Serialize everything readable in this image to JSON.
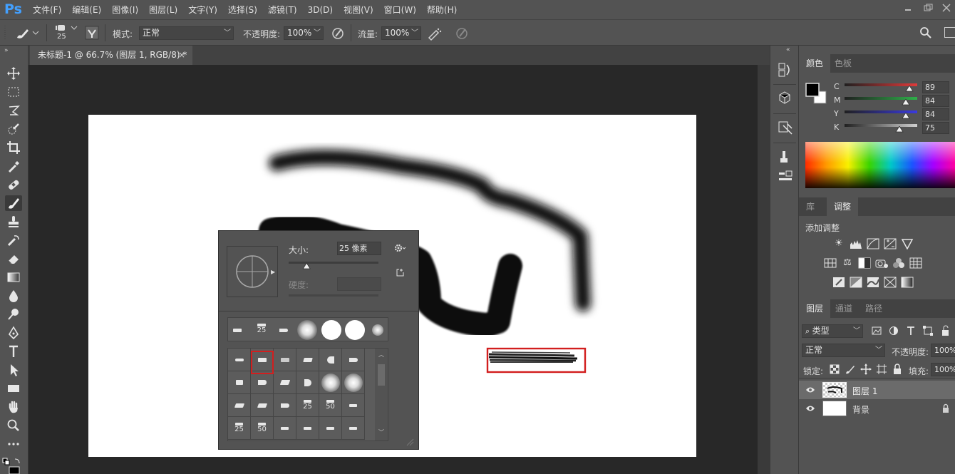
{
  "menubar": {
    "logo": "Ps",
    "items": [
      "文件(F)",
      "编辑(E)",
      "图像(I)",
      "图层(L)",
      "文字(Y)",
      "选择(S)",
      "滤镜(T)",
      "3D(D)",
      "视图(V)",
      "窗口(W)",
      "帮助(H)"
    ]
  },
  "options": {
    "brush_size": "25",
    "mode_label": "模式:",
    "mode_value": "正常",
    "opacity_label": "不透明度:",
    "opacity_value": "100%",
    "flow_label": "流量:",
    "flow_value": "100%"
  },
  "document": {
    "tab_title": "未标题-1 @ 66.7% (图层 1, RGB/8) *",
    "close": "×"
  },
  "color_panel": {
    "tabs": [
      "颜色",
      "色板"
    ],
    "channels": [
      {
        "label": "C",
        "value": "89",
        "level": 0.89,
        "color": "#e03a3a"
      },
      {
        "label": "M",
        "value": "84",
        "level": 0.84,
        "color": "#2fb04a"
      },
      {
        "label": "Y",
        "value": "84",
        "level": 0.84,
        "color": "#3a3ae0"
      },
      {
        "label": "K",
        "value": "75",
        "level": 0.75,
        "color": "#cfcfcf"
      }
    ]
  },
  "adjust_panel": {
    "tabs": [
      "库",
      "调整"
    ],
    "title": "添加调整"
  },
  "layers_panel": {
    "tabs": [
      "图层",
      "通道",
      "路径"
    ],
    "filter_label": "类型",
    "blend_mode": "正常",
    "opacity_label": "不透明度:",
    "opacity_value": "100%",
    "lock_label": "锁定:",
    "fill_label": "填充:",
    "fill_value": "100%",
    "layers": [
      {
        "name": "图层 1",
        "selected": true
      },
      {
        "name": "背景",
        "selected": false
      }
    ]
  },
  "brush_popup": {
    "size_label": "大小:",
    "size_value": "25 像素",
    "size_level": 0.2,
    "hardness_label": "硬度:",
    "preset_row_labels": [
      "25"
    ],
    "grid_labels": {
      "r2": [
        "25",
        "50"
      ],
      "r3": [
        "25",
        "50"
      ]
    }
  }
}
